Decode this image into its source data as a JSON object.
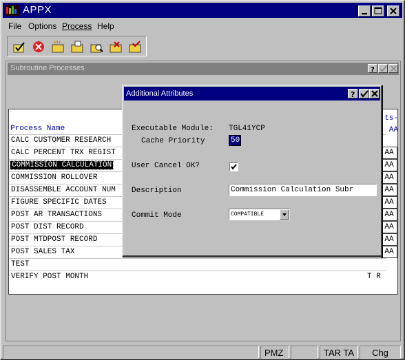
{
  "window": {
    "title": "APPX"
  },
  "menu": [
    {
      "label": "File"
    },
    {
      "label": "Options"
    },
    {
      "label": "Process"
    },
    {
      "label": "Help"
    }
  ],
  "toolbar": [
    "ok-check-icon",
    "cancel-icon",
    "new-folder-icon",
    "open-folder-icon",
    "find-folder-icon",
    "folder-x-icon",
    "folder-check-icon"
  ],
  "child": {
    "title": "Subroutine Processes",
    "column_header": "Process Name",
    "aa_header_top": "ts-",
    "aa_header_bottom": "AA",
    "rows": [
      {
        "name": "CALC CUSTOMER RESEARCH",
        "aa": "",
        "extra": ""
      },
      {
        "name": "CALC PERCENT TRX REGIST",
        "aa": "AA",
        "extra": ""
      },
      {
        "name": "COMMISSION CALCULATION",
        "aa": "AA",
        "extra": "",
        "selected": true
      },
      {
        "name": "COMMISSION ROLLOVER",
        "aa": "AA",
        "extra": ""
      },
      {
        "name": "DISASSEMBLE ACCOUNT NUM",
        "aa": "AA",
        "extra": ""
      },
      {
        "name": "FIGURE SPECIFIC DATES",
        "aa": "AA",
        "extra": ""
      },
      {
        "name": "POST AR TRANSACTIONS",
        "aa": "AA",
        "extra": ""
      },
      {
        "name": "POST DIST RECORD",
        "aa": "AA",
        "extra": ""
      },
      {
        "name": "POST MTDPOST RECORD",
        "aa": "AA",
        "extra": ""
      },
      {
        "name": "POST SALES TAX",
        "aa": "AA",
        "extra": ""
      },
      {
        "name": "TEST",
        "aa": "",
        "extra": ""
      },
      {
        "name": "VERIFY POST MONTH",
        "aa": "",
        "extra": "T R"
      }
    ]
  },
  "dialog": {
    "title": "Additional Attributes",
    "executable_module_label": "Executable Module:",
    "executable_module_value": "TGL41YCP",
    "cache_priority_label": "Cache Priority",
    "cache_priority_value": "50",
    "user_cancel_label": "User Cancel OK?",
    "user_cancel_checked": true,
    "description_label": "Description",
    "description_value": "Commission Calculation Subr",
    "commit_mode_label": "Commit Mode",
    "commit_mode_value": "COMPATIBLE"
  },
  "status": {
    "cells": [
      "",
      "PMZ",
      "",
      "TAR TA",
      "Chg"
    ]
  },
  "colors": {
    "titlebar": "#000080",
    "face": "#c0c0c0",
    "header_text": "#0000a8"
  }
}
